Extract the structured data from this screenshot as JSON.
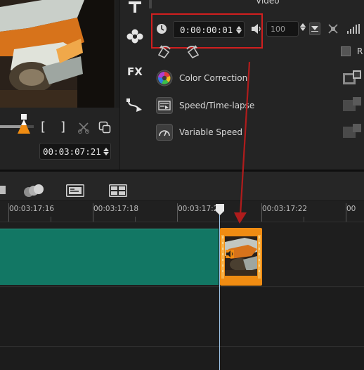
{
  "options_panel": {
    "title": "Video",
    "duration_timecode": "0:00:00:01",
    "volume_value": "100",
    "items": [
      {
        "label": "Color Correction",
        "icon": "color-wheel-icon"
      },
      {
        "label": "Speed/Time-lapse",
        "icon": "speed-timelapse-icon"
      },
      {
        "label": "Variable Speed",
        "icon": "variable-speed-icon"
      }
    ],
    "right_checkbox_label": "R"
  },
  "preview": {
    "timecode": "00:03:07:21",
    "mark_in_label": "[",
    "mark_out_label": "]"
  },
  "timeline": {
    "ruler_labels": [
      "00:03:17:16",
      "00:03:17:18",
      "00:03:17:20",
      "00:03:17:22",
      "00"
    ]
  },
  "colors": {
    "highlight": "#d11f1f",
    "arrow": "#b01c1c",
    "clip_teal": "#127764",
    "clip_orange": "#f08c12",
    "playhead": "#9ec4e6"
  }
}
